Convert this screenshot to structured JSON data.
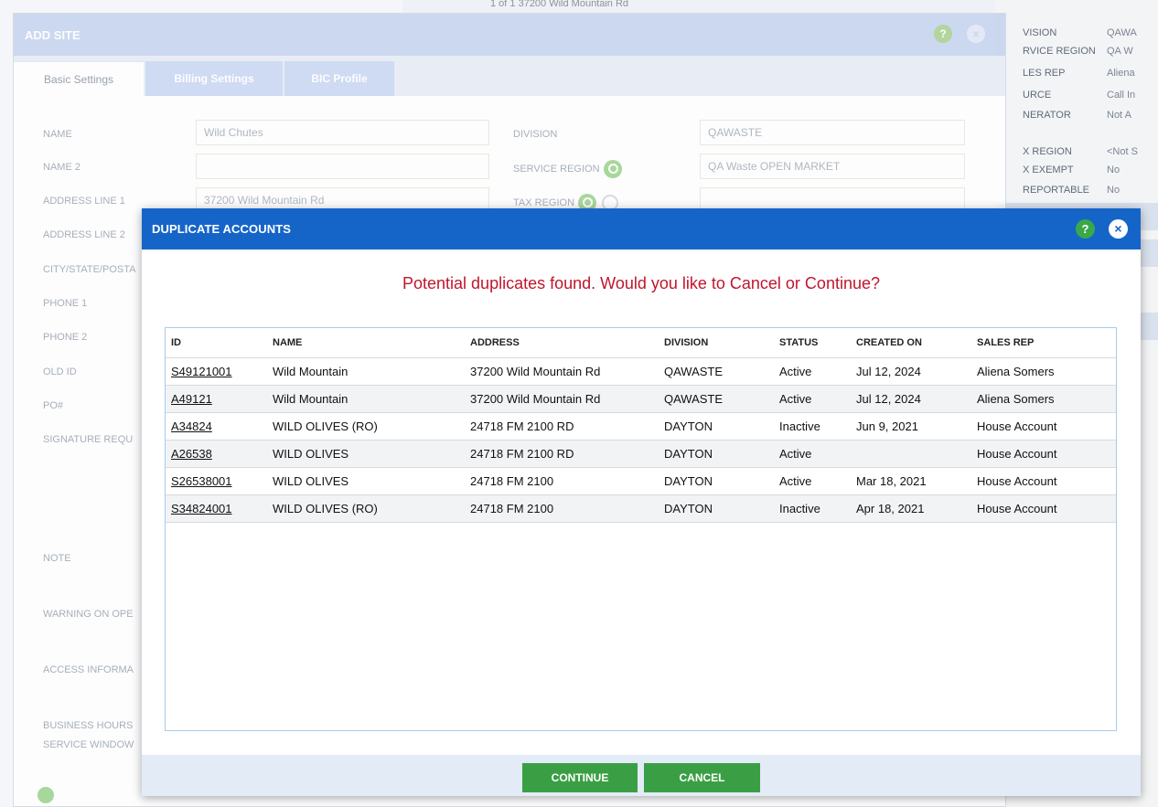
{
  "background": {
    "top_text": "1 of 1   37200 Wild Mountain Rd",
    "right_panel": [
      {
        "label": "VISION",
        "value": "QAWA"
      },
      {
        "label": "RVICE REGION",
        "value": "QA W"
      },
      {
        "label": "LES REP",
        "value": "Aliena"
      },
      {
        "label": "URCE",
        "value": "Call In"
      },
      {
        "label": "NERATOR",
        "value": "Not A"
      },
      {
        "label": "X REGION",
        "value": "<Not S"
      },
      {
        "label": "X EXEMPT",
        "value": "No"
      },
      {
        "label": "REPORTABLE",
        "value": "No"
      }
    ]
  },
  "add_site": {
    "title": "ADD SITE",
    "tabs": [
      "Basic Settings",
      "Billing Settings",
      "BIC Profile"
    ],
    "left_labels": [
      "NAME",
      "NAME 2",
      "ADDRESS LINE 1",
      "ADDRESS LINE 2",
      "CITY/STATE/POSTA",
      "PHONE 1",
      "PHONE 2",
      "OLD ID",
      "PO#",
      "SIGNATURE REQU",
      "NOTE",
      "WARNING ON OPE",
      "ACCESS INFORMA",
      "BUSINESS HOURS",
      "SERVICE WINDOW"
    ],
    "name_value": "Wild Chutes",
    "address1_value": "37200 Wild Mountain Rd",
    "division_label": "DIVISION",
    "division_value": "QAWASTE",
    "service_region_label": "SERVICE REGION",
    "service_region_value": "QA Waste OPEN MARKET",
    "tax_region_label": "TAX REGION"
  },
  "modal": {
    "title": "DUPLICATE ACCOUNTS",
    "help": "?",
    "close": "×",
    "message": "Potential duplicates found. Would you like to Cancel or Continue?",
    "columns": [
      "ID",
      "NAME",
      "ADDRESS",
      "DIVISION",
      "STATUS",
      "CREATED ON",
      "SALES REP"
    ],
    "rows": [
      {
        "id": "S49121001",
        "name": "Wild Mountain",
        "address": "37200 Wild Mountain Rd",
        "division": "QAWASTE",
        "status": "Active",
        "created": "Jul 12, 2024",
        "rep": "Aliena Somers"
      },
      {
        "id": "A49121",
        "name": "Wild Mountain",
        "address": "37200 Wild Mountain Rd",
        "division": "QAWASTE",
        "status": "Active",
        "created": "Jul 12, 2024",
        "rep": "Aliena Somers"
      },
      {
        "id": "A34824",
        "name": "WILD OLIVES (RO)",
        "address": "24718 FM 2100 RD",
        "division": "DAYTON",
        "status": "Inactive",
        "created": "Jun 9, 2021",
        "rep": "House Account"
      },
      {
        "id": "A26538",
        "name": "WILD OLIVES",
        "address": "24718 FM 2100 RD",
        "division": "DAYTON",
        "status": "Active",
        "created": "",
        "rep": "House Account"
      },
      {
        "id": "S26538001",
        "name": "WILD OLIVES",
        "address": "24718 FM 2100",
        "division": "DAYTON",
        "status": "Active",
        "created": "Mar 18, 2021",
        "rep": "House Account"
      },
      {
        "id": "S34824001",
        "name": "WILD OLIVES (RO)",
        "address": "24718 FM 2100",
        "division": "DAYTON",
        "status": "Inactive",
        "created": "Apr 18, 2021",
        "rep": "House Account"
      }
    ],
    "continue_label": "CONTINUE",
    "cancel_label": "CANCEL"
  }
}
